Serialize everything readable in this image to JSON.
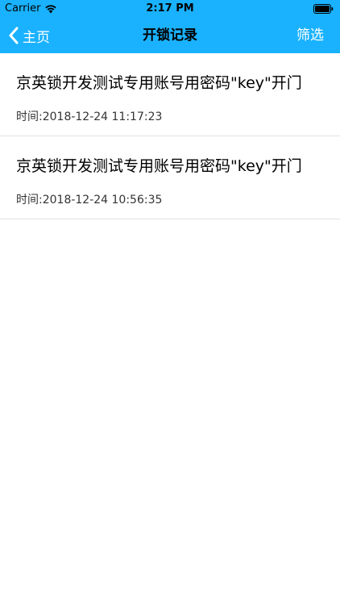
{
  "status_bar": {
    "carrier": "Carrier",
    "time": "2:17 PM"
  },
  "nav": {
    "back_label": "主页",
    "title": "开锁记录",
    "right_label": "筛选"
  },
  "records": [
    {
      "title": "京英锁开发测试专用账号用密码\"key\"开门",
      "time": "时间:2018-12-24 11:17:23"
    },
    {
      "title": "京英锁开发测试专用账号用密码\"key\"开门",
      "time": "时间:2018-12-24 10:56:35"
    }
  ],
  "colors": {
    "nav_bg": "#1ab2ff",
    "divider": "#e0e0e0"
  }
}
